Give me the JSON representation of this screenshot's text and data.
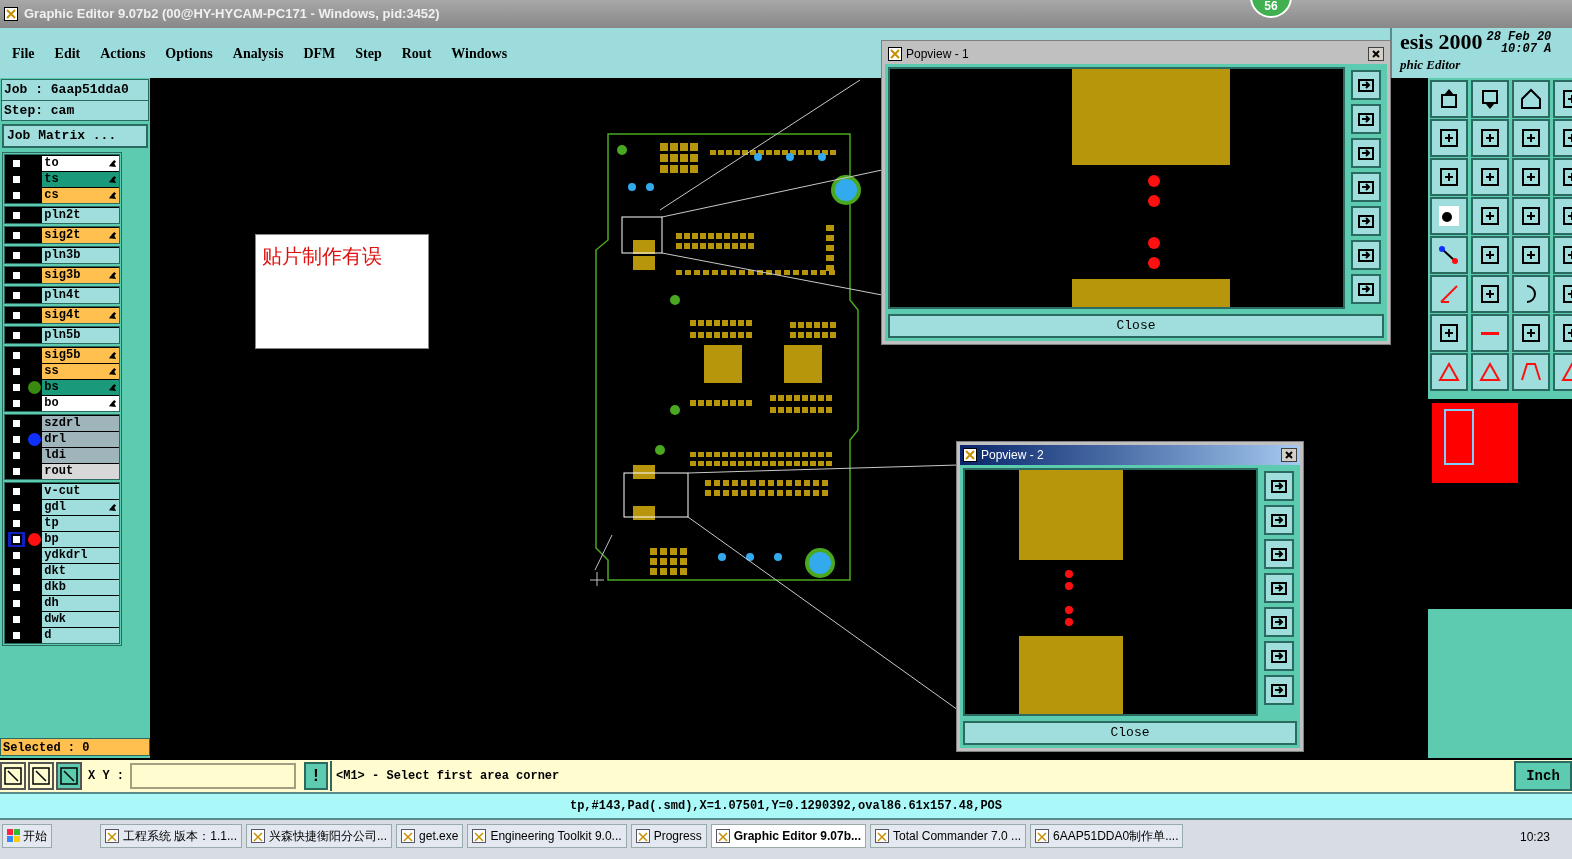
{
  "window": {
    "title": "Graphic Editor 9.07b2 (00@HY-HYCAM-PC171 - Windows, pid:3452)",
    "badge": "56"
  },
  "menu": [
    "File",
    "Edit",
    "Actions",
    "Options",
    "Analysis",
    "DFM",
    "Step",
    "Rout",
    "Windows"
  ],
  "header": {
    "product": "esis 2000",
    "date": "28 Feb 20",
    "time": "10:07 A",
    "subtitle": "phic Editor"
  },
  "job": {
    "job": "Job : 6aap51dda0",
    "step": "Step: cam",
    "matrix_button": "Job Matrix ..."
  },
  "layer_groups": [
    {
      "layers": [
        {
          "name": "to",
          "color": "#ffffff",
          "arrow": true,
          "checked": false,
          "selected": false
        },
        {
          "name": "ts",
          "color": "#1a9a7a",
          "arrow": true,
          "checked": false,
          "selected": false
        },
        {
          "name": "cs",
          "color": "#ffc050",
          "arrow": true,
          "checked": false,
          "selected": false
        }
      ]
    },
    {
      "layers": [
        {
          "name": "pln2t",
          "color": "#a0dede",
          "arrow": false,
          "checked": false,
          "selected": false
        }
      ]
    },
    {
      "layers": [
        {
          "name": "sig2t",
          "color": "#ffc050",
          "arrow": true,
          "checked": false,
          "selected": false
        }
      ]
    },
    {
      "layers": [
        {
          "name": "pln3b",
          "color": "#a0dede",
          "arrow": false,
          "checked": false,
          "selected": false
        }
      ]
    },
    {
      "layers": [
        {
          "name": "sig3b",
          "color": "#ffc050",
          "arrow": true,
          "checked": false,
          "selected": false
        }
      ]
    },
    {
      "layers": [
        {
          "name": "pln4t",
          "color": "#a0dede",
          "arrow": false,
          "checked": false,
          "selected": false
        }
      ]
    },
    {
      "layers": [
        {
          "name": "sig4t",
          "color": "#ffc050",
          "arrow": true,
          "checked": false,
          "selected": false
        }
      ]
    },
    {
      "layers": [
        {
          "name": "pln5b",
          "color": "#a0dede",
          "arrow": false,
          "checked": false,
          "selected": false
        }
      ]
    },
    {
      "layers": [
        {
          "name": "sig5b",
          "color": "#ffc050",
          "arrow": true,
          "checked": false,
          "selected": false
        },
        {
          "name": "ss",
          "color": "#ffc050",
          "arrow": true,
          "checked": false,
          "selected": false
        },
        {
          "name": "bs",
          "color": "#1a9a7a",
          "marker": {
            "color": "#3a8a10"
          },
          "arrow": true,
          "checked": false,
          "selected": false
        },
        {
          "name": "bo",
          "color": "#ffffff",
          "arrow": true,
          "checked": false,
          "selected": false
        }
      ]
    },
    {
      "layers": [
        {
          "name": "szdrl",
          "color": "#a0b4bc",
          "arrow": false,
          "checked": false,
          "selected": false
        },
        {
          "name": "drl",
          "color": "#a0b4bc",
          "marker": {
            "color": "#1030ff"
          },
          "arrow": false,
          "checked": false,
          "selected": false
        },
        {
          "name": "ldi",
          "color": "#a0b4bc",
          "arrow": false,
          "checked": false,
          "selected": false
        },
        {
          "name": "rout",
          "color": "#d8d8d8",
          "arrow": false,
          "checked": false,
          "selected": false
        }
      ]
    },
    {
      "layers": [
        {
          "name": "v-cut",
          "color": "#a0dede",
          "arrow": false,
          "checked": false,
          "selected": false
        },
        {
          "name": "gdl",
          "color": "#a0dede",
          "arrow": true,
          "checked": false,
          "selected": false
        },
        {
          "name": "tp",
          "color": "#a0dede",
          "arrow": false,
          "checked": false,
          "selected": false
        },
        {
          "name": "bp",
          "color": "#a0dede",
          "marker": {
            "color": "#ff1010"
          },
          "arrow": false,
          "checked": false,
          "selected": true
        },
        {
          "name": "ydkdrl",
          "color": "#a0dede",
          "arrow": false,
          "checked": false,
          "selected": false
        },
        {
          "name": "dkt",
          "color": "#a0dede",
          "arrow": false,
          "checked": false,
          "selected": false
        },
        {
          "name": "dkb",
          "color": "#a0dede",
          "arrow": false,
          "checked": false,
          "selected": false
        },
        {
          "name": "dh",
          "color": "#a0dede",
          "arrow": false,
          "checked": false,
          "selected": false
        },
        {
          "name": "dwk",
          "color": "#a0dede",
          "arrow": false,
          "checked": false,
          "selected": false
        },
        {
          "name": "d",
          "color": "#a0dede",
          "arrow": false,
          "checked": false,
          "selected": false
        }
      ]
    }
  ],
  "selected_count": "Selected : 0",
  "note": "贴片制作有误",
  "popviews": [
    {
      "title": "Popview - 1",
      "active": false,
      "close": "Close"
    },
    {
      "title": "Popview - 2",
      "active": true,
      "close": "Close"
    }
  ],
  "command": {
    "xy_label": "X Y :",
    "bang": "!",
    "message": "<M1> - Select first area corner",
    "units": "Inch"
  },
  "status": "tp,#143,Pad(.smd),X=1.07501,Y=0.1290392,oval86.61x157.48,POS",
  "taskbar": {
    "start": "开始",
    "items": [
      {
        "label": "工程系统  版本：1.1...",
        "selected": false
      },
      {
        "label": "兴森快捷衡阳分公司...",
        "selected": false
      },
      {
        "label": "get.exe",
        "selected": false
      },
      {
        "label": "Engineering Toolkit 9.0...",
        "selected": false
      },
      {
        "label": "Progress",
        "selected": false
      },
      {
        "label": "Graphic Editor 9.07b...",
        "selected": true
      },
      {
        "label": "Total Commander 7.0 ...",
        "selected": false
      },
      {
        "label": "6AAP51DDA0制作单....",
        "selected": false
      }
    ],
    "clock": "10:23"
  }
}
